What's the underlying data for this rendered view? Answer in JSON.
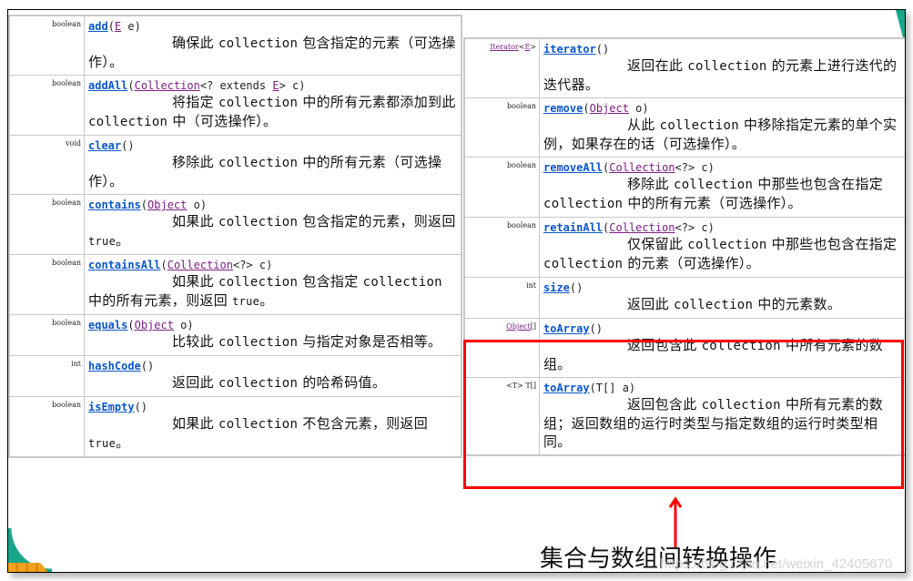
{
  "colors": {
    "method_link": "#0b56c9",
    "type_link": "#7a1d82",
    "highlight_border": "#ff0000",
    "accent_teal": "#1aa58a",
    "accent_orange": "#f3a21c"
  },
  "left_methods": [
    {
      "return_type": "boolean",
      "name": "add",
      "params": [
        {
          "kind": "plain",
          "text": "("
        },
        {
          "kind": "link",
          "text": "E"
        },
        {
          "kind": "plain",
          "text": " e)"
        }
      ],
      "description_parts": [
        {
          "kind": "cjk",
          "text": "确保此 "
        },
        {
          "kind": "mono",
          "text": "collection"
        },
        {
          "kind": "cjk",
          "text": " 包含指定的元素（可选操作）。"
        }
      ]
    },
    {
      "return_type": "boolean",
      "name": "addAll",
      "params": [
        {
          "kind": "plain",
          "text": "("
        },
        {
          "kind": "link",
          "text": "Collection"
        },
        {
          "kind": "plain",
          "text": "<? extends "
        },
        {
          "kind": "link",
          "text": "E"
        },
        {
          "kind": "plain",
          "text": "> c)"
        }
      ],
      "description_parts": [
        {
          "kind": "cjk",
          "text": "将指定 "
        },
        {
          "kind": "mono",
          "text": "collection"
        },
        {
          "kind": "cjk",
          "text": " 中的所有元素都添加到此 "
        },
        {
          "kind": "mono",
          "text": "collection"
        },
        {
          "kind": "cjk",
          "text": " 中（可选操作）。"
        }
      ]
    },
    {
      "return_type": "void",
      "name": "clear",
      "params": [
        {
          "kind": "plain",
          "text": "()"
        }
      ],
      "description_parts": [
        {
          "kind": "cjk",
          "text": "移除此 "
        },
        {
          "kind": "mono",
          "text": "collection"
        },
        {
          "kind": "cjk",
          "text": " 中的所有元素（可选操作）。"
        }
      ]
    },
    {
      "return_type": "boolean",
      "name": "contains",
      "params": [
        {
          "kind": "plain",
          "text": "("
        },
        {
          "kind": "link",
          "text": "Object"
        },
        {
          "kind": "plain",
          "text": " o)"
        }
      ],
      "description_parts": [
        {
          "kind": "cjk",
          "text": "如果此 "
        },
        {
          "kind": "mono",
          "text": "collection"
        },
        {
          "kind": "cjk",
          "text": " 包含指定的元素，则返回 "
        },
        {
          "kind": "small",
          "text": "true"
        },
        {
          "kind": "cjk",
          "text": "。"
        }
      ]
    },
    {
      "return_type": "boolean",
      "name": "containsAll",
      "params": [
        {
          "kind": "plain",
          "text": "("
        },
        {
          "kind": "link",
          "text": "Collection"
        },
        {
          "kind": "plain",
          "text": "<?> c)"
        }
      ],
      "description_parts": [
        {
          "kind": "cjk",
          "text": "如果此 "
        },
        {
          "kind": "mono",
          "text": "collection"
        },
        {
          "kind": "cjk",
          "text": " 包含指定 "
        },
        {
          "kind": "mono",
          "text": "collection"
        },
        {
          "kind": "cjk",
          "text": " 中的所有元素，则返回 "
        },
        {
          "kind": "small",
          "text": "true"
        },
        {
          "kind": "cjk",
          "text": "。"
        }
      ]
    },
    {
      "return_type": "boolean",
      "name": "equals",
      "params": [
        {
          "kind": "plain",
          "text": "("
        },
        {
          "kind": "link",
          "text": "Object"
        },
        {
          "kind": "plain",
          "text": " o)"
        }
      ],
      "description_parts": [
        {
          "kind": "cjk",
          "text": "比较此 "
        },
        {
          "kind": "mono",
          "text": "collection"
        },
        {
          "kind": "cjk",
          "text": " 与指定对象是否相等。"
        }
      ]
    },
    {
      "return_type": "int",
      "name": "hashCode",
      "params": [
        {
          "kind": "plain",
          "text": "()"
        }
      ],
      "description_parts": [
        {
          "kind": "cjk",
          "text": "返回此 "
        },
        {
          "kind": "mono",
          "text": "collection"
        },
        {
          "kind": "cjk",
          "text": " 的哈希码值。"
        }
      ]
    },
    {
      "return_type": "boolean",
      "name": "isEmpty",
      "params": [
        {
          "kind": "plain",
          "text": "()"
        }
      ],
      "description_parts": [
        {
          "kind": "cjk",
          "text": "如果此 "
        },
        {
          "kind": "mono",
          "text": "collection"
        },
        {
          "kind": "cjk",
          "text": " 不包含元素，则返回 "
        },
        {
          "kind": "small",
          "text": "true"
        },
        {
          "kind": "cjk",
          "text": "。"
        }
      ]
    }
  ],
  "right_methods": [
    {
      "return_type_parts": [
        {
          "kind": "link",
          "text": "Iterator"
        },
        {
          "kind": "plain",
          "text": "<"
        },
        {
          "kind": "link",
          "text": "E"
        },
        {
          "kind": "plain",
          "text": ">"
        }
      ],
      "name": "iterator",
      "params": [
        {
          "kind": "plain",
          "text": "()"
        }
      ],
      "description_parts": [
        {
          "kind": "cjk",
          "text": "返回在此 "
        },
        {
          "kind": "mono",
          "text": "collection"
        },
        {
          "kind": "cjk",
          "text": " 的元素上进行迭代的迭代器。"
        }
      ]
    },
    {
      "return_type_parts": [
        {
          "kind": "plain",
          "text": "boolean"
        }
      ],
      "name": "remove",
      "params": [
        {
          "kind": "plain",
          "text": "("
        },
        {
          "kind": "link",
          "text": "Object"
        },
        {
          "kind": "plain",
          "text": " o)"
        }
      ],
      "description_parts": [
        {
          "kind": "cjk",
          "text": "从此 "
        },
        {
          "kind": "mono",
          "text": "collection"
        },
        {
          "kind": "cjk",
          "text": " 中移除指定元素的单个实例，如果存在的话（可选操作）。"
        }
      ]
    },
    {
      "return_type_parts": [
        {
          "kind": "plain",
          "text": "boolean"
        }
      ],
      "name": "removeAll",
      "params": [
        {
          "kind": "plain",
          "text": "("
        },
        {
          "kind": "link",
          "text": "Collection"
        },
        {
          "kind": "plain",
          "text": "<?> c)"
        }
      ],
      "description_parts": [
        {
          "kind": "cjk",
          "text": "移除此 "
        },
        {
          "kind": "mono",
          "text": "collection"
        },
        {
          "kind": "cjk",
          "text": " 中那些也包含在指定 "
        },
        {
          "kind": "mono",
          "text": "collection"
        },
        {
          "kind": "cjk",
          "text": " 中的所有元素（可选操作）。"
        }
      ]
    },
    {
      "return_type_parts": [
        {
          "kind": "plain",
          "text": "boolean"
        }
      ],
      "name": "retainAll",
      "params": [
        {
          "kind": "plain",
          "text": "("
        },
        {
          "kind": "link",
          "text": "Collection"
        },
        {
          "kind": "plain",
          "text": "<?> c)"
        }
      ],
      "description_parts": [
        {
          "kind": "cjk",
          "text": "仅保留此 "
        },
        {
          "kind": "mono",
          "text": "collection"
        },
        {
          "kind": "cjk",
          "text": " 中那些也包含在指定 "
        },
        {
          "kind": "mono",
          "text": "collection"
        },
        {
          "kind": "cjk",
          "text": " 的元素（可选操作）。"
        }
      ]
    },
    {
      "return_type_parts": [
        {
          "kind": "plain",
          "text": "int"
        }
      ],
      "name": "size",
      "params": [
        {
          "kind": "plain",
          "text": "()"
        }
      ],
      "description_parts": [
        {
          "kind": "cjk",
          "text": "返回此 "
        },
        {
          "kind": "mono",
          "text": "collection"
        },
        {
          "kind": "cjk",
          "text": " 中的元素数。"
        }
      ]
    },
    {
      "return_type_parts": [
        {
          "kind": "link",
          "text": "Object"
        },
        {
          "kind": "plain",
          "text": "[]"
        }
      ],
      "name": "toArray",
      "params": [
        {
          "kind": "plain",
          "text": "()"
        }
      ],
      "description_parts": [
        {
          "kind": "cjk",
          "text": "返回包含此 "
        },
        {
          "kind": "mono",
          "text": "collection"
        },
        {
          "kind": "cjk",
          "text": " 中所有元素的数组。"
        }
      ]
    },
    {
      "return_type_parts": [
        {
          "kind": "plain",
          "text": "<T> T[]"
        }
      ],
      "name": "toArray",
      "params": [
        {
          "kind": "plain",
          "text": "(T[] a)"
        }
      ],
      "description_parts": [
        {
          "kind": "cjk",
          "text": "返回包含此 "
        },
        {
          "kind": "mono",
          "text": "collection"
        },
        {
          "kind": "cjk",
          "text": " 中所有元素的数组；返回数组的运行时类型与指定数组的运行时类型相同。"
        }
      ]
    }
  ],
  "annotation": {
    "caption": "集合与数组间转换操作",
    "highlighted_methods": [
      "toArray()",
      "toArray(T[] a)"
    ]
  },
  "watermark": "https://blog.csdn.net/weixin_42405670"
}
